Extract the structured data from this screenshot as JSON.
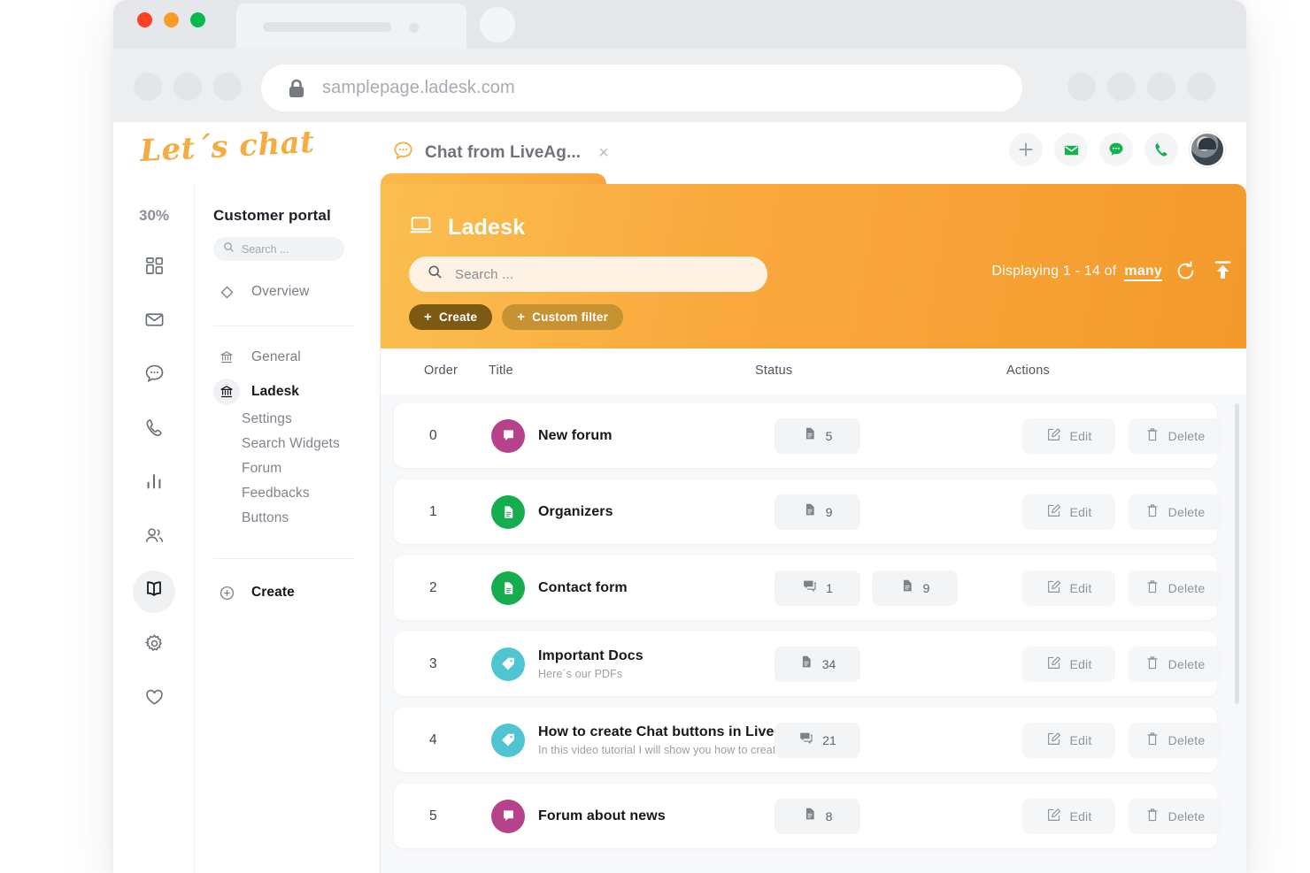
{
  "browser": {
    "url": "samplepage.ladesk.com",
    "lock_icon": "lock-icon"
  },
  "app_header": {
    "brand": "Let´s chat",
    "tab_label": "Chat from LiveAg...",
    "tab_close": "×",
    "actions": [
      {
        "name": "add-button",
        "icon": "plus-icon"
      },
      {
        "name": "mail-button",
        "icon": "envelope-icon"
      },
      {
        "name": "chat-button",
        "icon": "chat-bubble-icon"
      },
      {
        "name": "call-button",
        "icon": "phone-icon"
      }
    ]
  },
  "icon_sidebar": {
    "zoom_level": "30%",
    "items": [
      {
        "name": "sidebar-item-dashboard",
        "icon": "grid-icon",
        "active": false
      },
      {
        "name": "sidebar-item-mail",
        "icon": "envelope-icon",
        "active": false
      },
      {
        "name": "sidebar-item-chat",
        "icon": "chat-bubble-icon",
        "active": false
      },
      {
        "name": "sidebar-item-calls",
        "icon": "phone-icon",
        "active": false
      },
      {
        "name": "sidebar-item-reports",
        "icon": "bar-chart-icon",
        "active": false
      },
      {
        "name": "sidebar-item-contacts",
        "icon": "people-icon",
        "active": false
      },
      {
        "name": "sidebar-item-knowledge-base",
        "icon": "book-icon",
        "active": true
      },
      {
        "name": "sidebar-item-settings",
        "icon": "gear-icon",
        "active": false
      },
      {
        "name": "sidebar-item-favorites",
        "icon": "heart-icon",
        "active": false
      }
    ]
  },
  "portal_nav": {
    "title": "Customer portal",
    "search_placeholder": "Search ...",
    "search_value": "",
    "overview_label": "Overview",
    "general_label": "General",
    "ladesk_label": "Ladesk",
    "sub_items": [
      "Settings",
      "Search Widgets",
      "Forum",
      "Feedbacks",
      "Buttons"
    ],
    "create_label": "Create"
  },
  "panel": {
    "title": "Ladesk",
    "title_icon": "monitor-icon",
    "search_placeholder": "Search ...",
    "search_value": "",
    "create_label": "Create",
    "custom_filter_label": "Custom filter",
    "displaying_text": "Displaying 1 - 14 of",
    "displaying_many": "many",
    "refresh_icon": "refresh-icon",
    "export_icon": "export-icon",
    "accent_light": "#fbbe50",
    "accent_dark": "#f49a2c"
  },
  "table": {
    "columns": [
      "Order",
      "Title",
      "Status",
      "Actions"
    ],
    "edit_label": "Edit",
    "delete_label": "Delete",
    "rows": [
      {
        "order": "0",
        "title": "New forum",
        "subtitle": "",
        "icon": "chat-bubble-icon",
        "icon_color": "#b5428a",
        "comments": "",
        "docs": "5"
      },
      {
        "order": "1",
        "title": "Organizers",
        "subtitle": "",
        "icon": "document-icon",
        "icon_color": "#15ad4d",
        "comments": "",
        "docs": "9"
      },
      {
        "order": "2",
        "title": "Contact form",
        "subtitle": "",
        "icon": "document-icon",
        "icon_color": "#15ad4d",
        "comments": "1",
        "docs": "9"
      },
      {
        "order": "3",
        "title": "Important Docs",
        "subtitle": "Here´s our PDFs",
        "icon": "tag-icon",
        "icon_color": "#4ec5d0",
        "comments": "",
        "docs": "34"
      },
      {
        "order": "4",
        "title": "How to create Chat buttons in LiveAgent",
        "subtitle": "In this video tutorial I will show you how to create...",
        "icon": "tag-icon",
        "icon_color": "#4ec5d0",
        "comments": "21",
        "docs": ""
      },
      {
        "order": "5",
        "title": "Forum about news",
        "subtitle": "",
        "icon": "chat-bubble-icon",
        "icon_color": "#b5428a",
        "comments": "",
        "docs": "8"
      }
    ]
  }
}
